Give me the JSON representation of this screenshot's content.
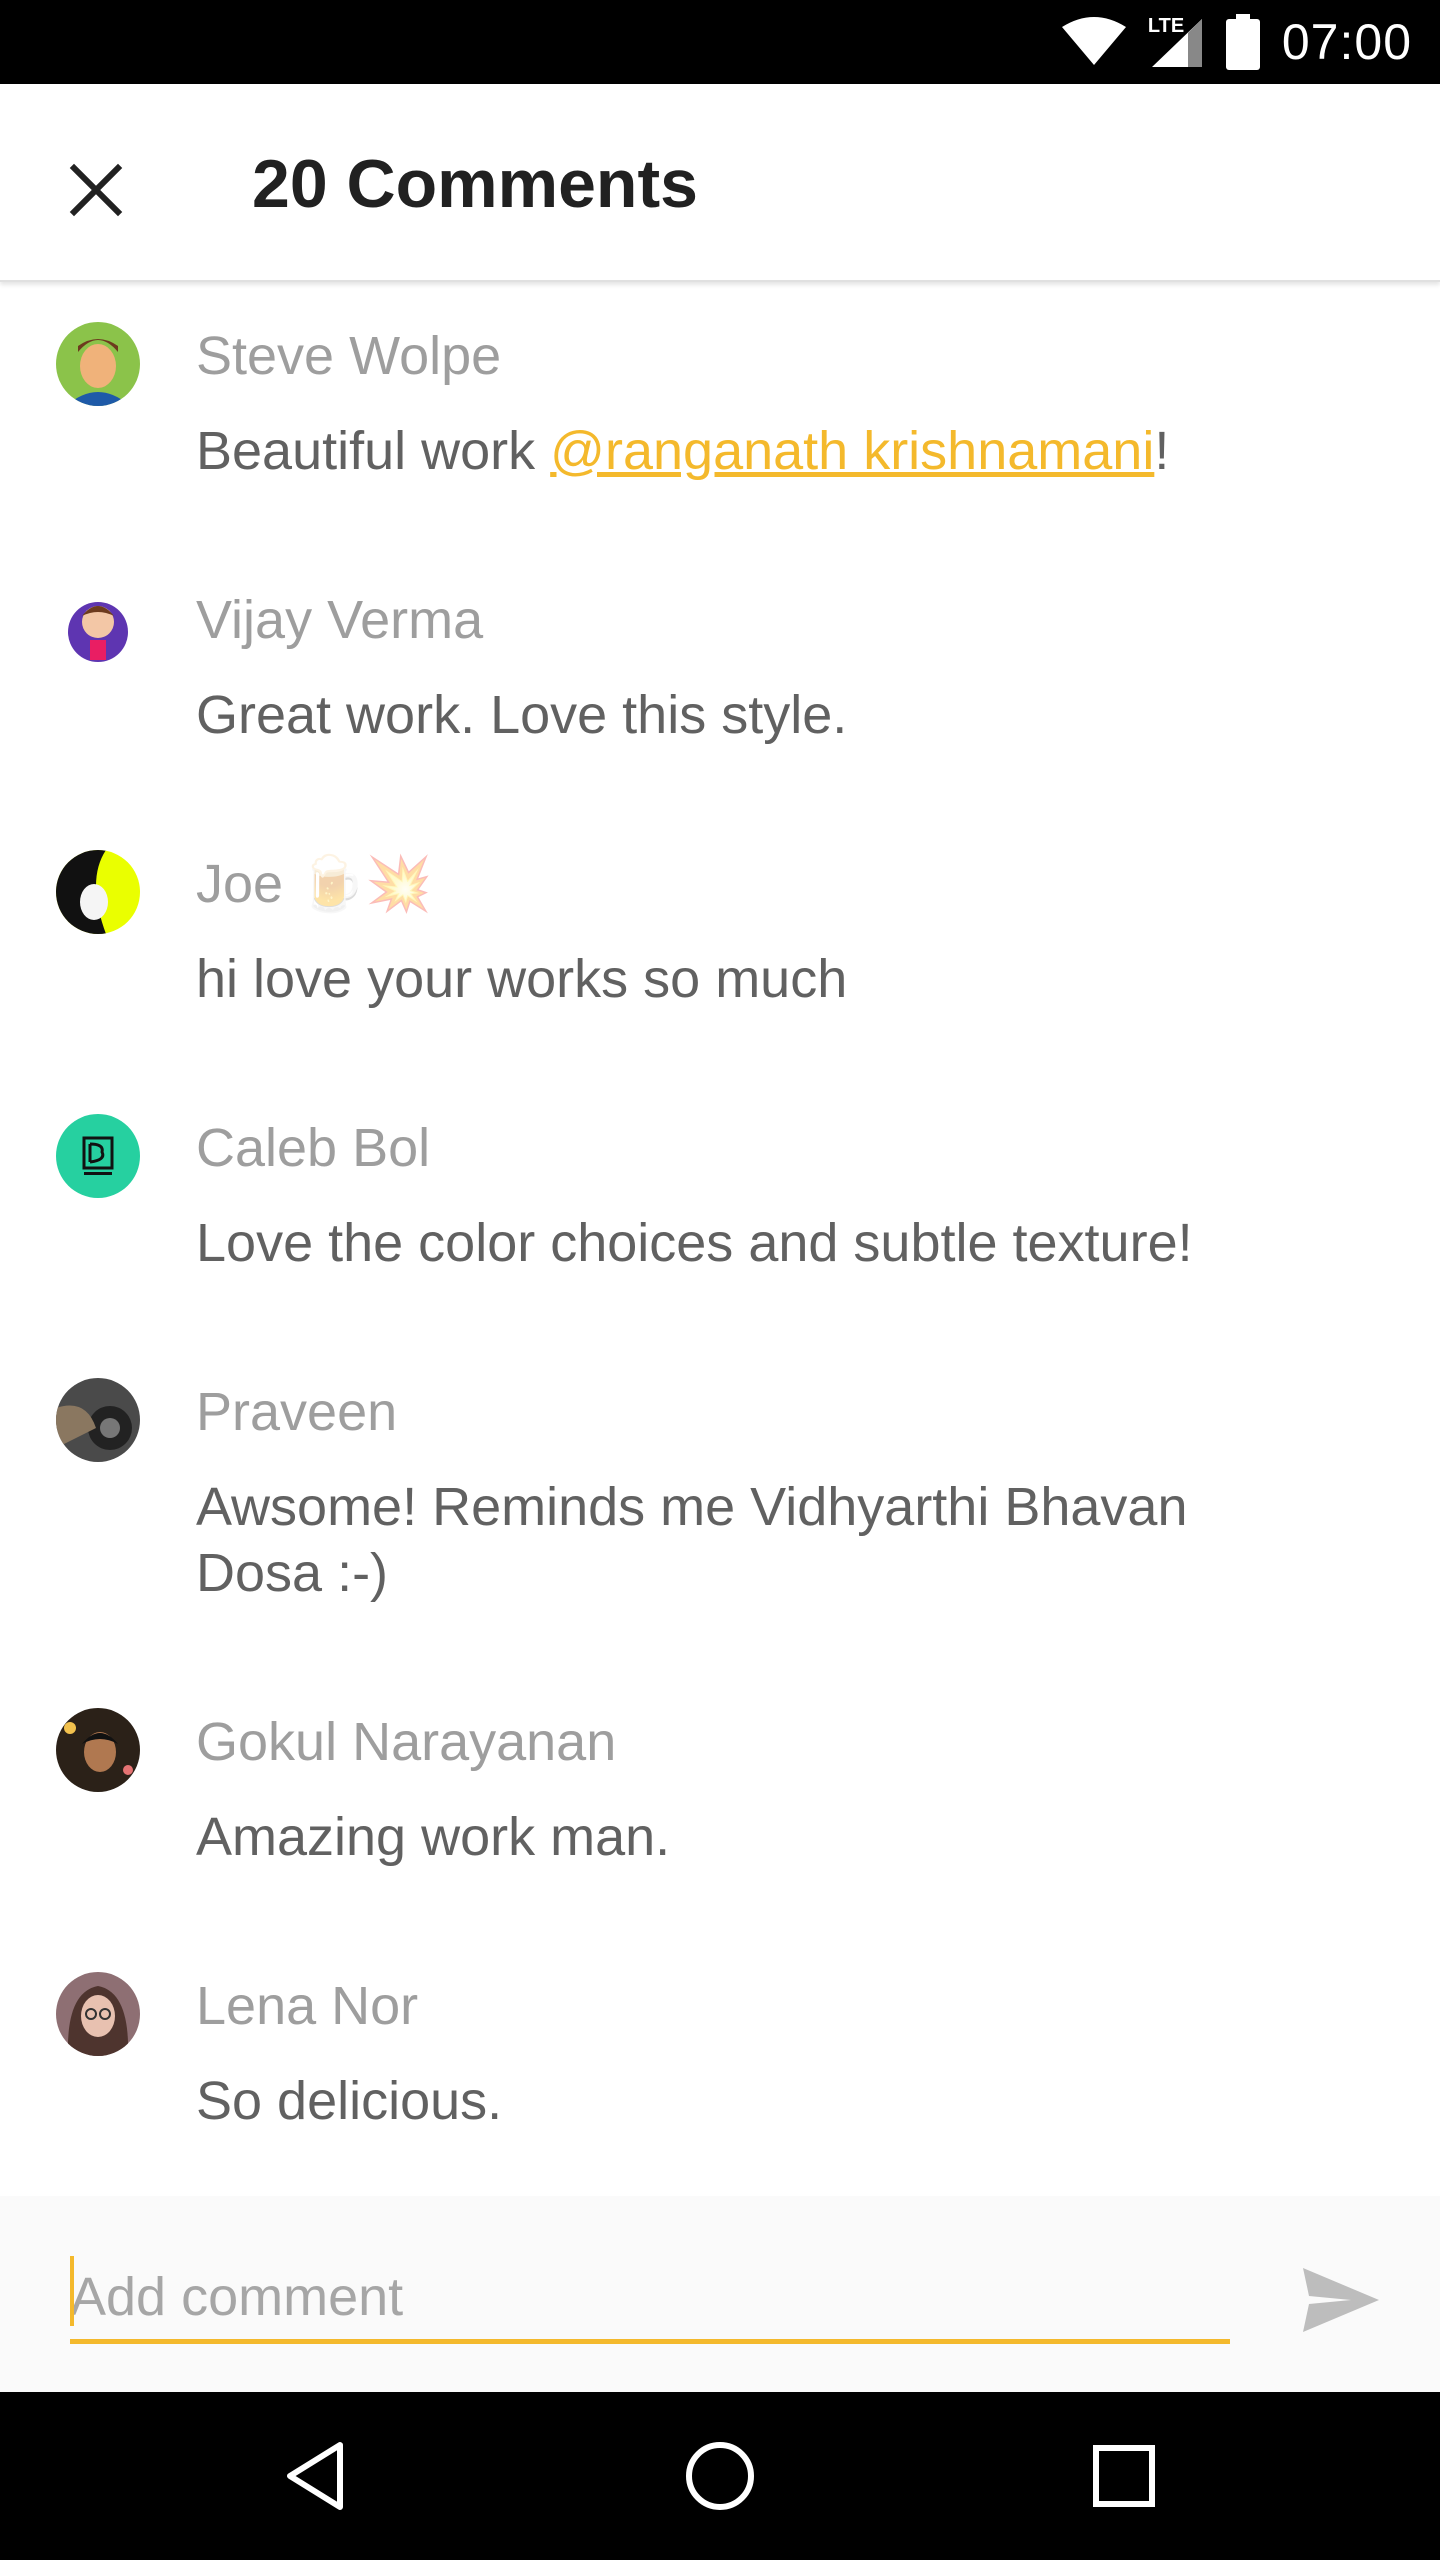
{
  "status_bar": {
    "time": "07:00",
    "network_label": "LTE",
    "icons": [
      "wifi-icon",
      "signal-icon",
      "battery-icon"
    ]
  },
  "app_bar": {
    "title": "20 Comments",
    "close_icon": "close-icon"
  },
  "comments": [
    {
      "name": "Steve Wolpe",
      "text_before": "Beautiful work ",
      "mention": "@ranganath krishnamani",
      "text_after": "!"
    },
    {
      "name": "Vijay Verma",
      "text": "Great work. Love this style."
    },
    {
      "name": "Joe",
      "name_emoji": "🍺💥",
      "text": "hi love your works so much"
    },
    {
      "name": "Caleb Bol",
      "text": "Love the color choices and subtle texture!"
    },
    {
      "name": "Praveen",
      "text": "Awsome! Reminds me Vidhyarthi Bhavan Dosa :-)"
    },
    {
      "name": "Gokul Narayanan",
      "text": "Amazing work man."
    },
    {
      "name": "Lena Nor",
      "text": "So delicious."
    }
  ],
  "input": {
    "placeholder": "Add comment",
    "value": "",
    "send_icon": "send-icon"
  },
  "nav_bar": {
    "icons": [
      "back-icon",
      "home-icon",
      "recents-icon"
    ]
  },
  "colors": {
    "accent": "#f4b92c",
    "name_text": "#9e9e9e",
    "body_text": "#616161",
    "title_text": "#212121"
  }
}
